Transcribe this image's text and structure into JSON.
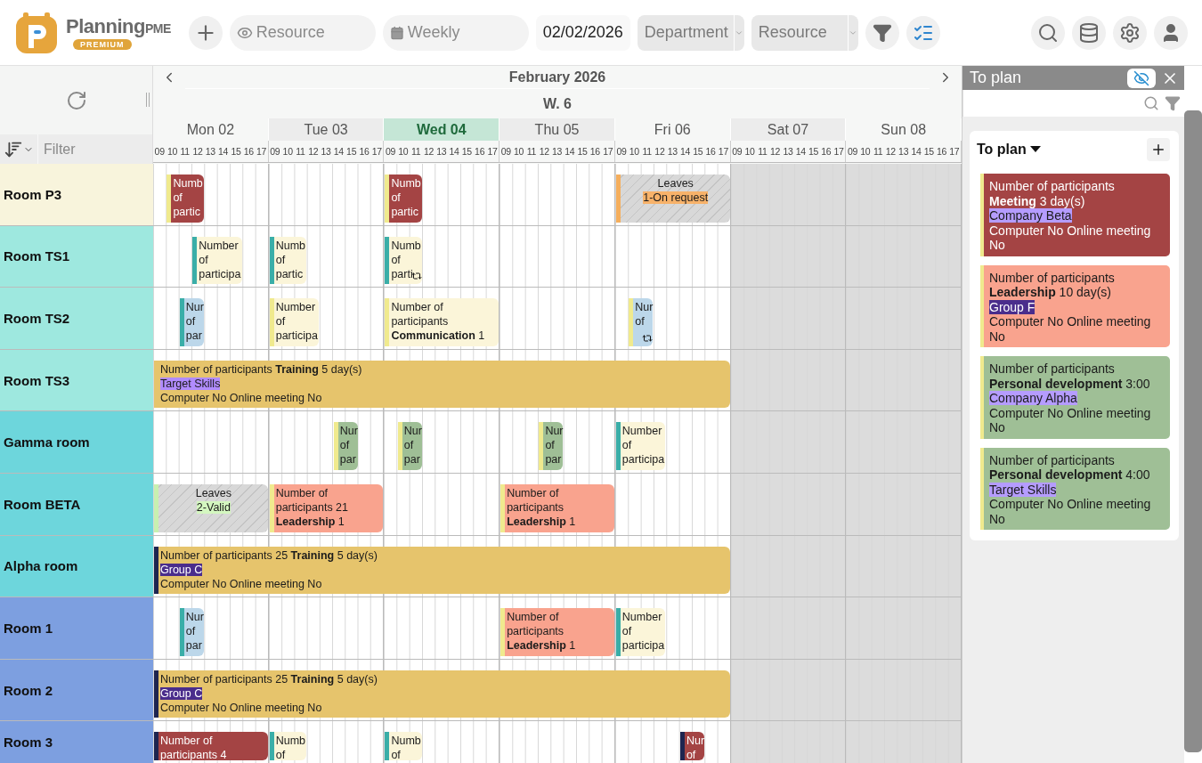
{
  "brand": {
    "name": "Planning",
    "suffix": "PME",
    "edition": "PREMIUM"
  },
  "toolbar": {
    "resource_filter": {
      "placeholder": "Resource"
    },
    "view": "Weekly",
    "date": "02/02/2026",
    "department": "Department",
    "resource_select": "Resource"
  },
  "planner": {
    "month": "February 2026",
    "week": "W. 6",
    "filter": {
      "placeholder": "Filter"
    },
    "days": [
      {
        "label": "Mon 02",
        "selected": false,
        "weekend": false,
        "hours": [
          "09",
          "10",
          "11",
          "12",
          "13",
          "14",
          "15",
          "16",
          "17"
        ]
      },
      {
        "label": "Tue 03",
        "selected": false,
        "weekend": false,
        "hours": [
          "09",
          "10",
          "11",
          "12",
          "13",
          "14",
          "15",
          "16",
          "17"
        ]
      },
      {
        "label": "Wed 04",
        "selected": true,
        "weekend": false,
        "hours": [
          "09",
          "10",
          "11",
          "12",
          "13",
          "14",
          "15",
          "16",
          "17"
        ]
      },
      {
        "label": "Thu 05",
        "selected": false,
        "weekend": false,
        "hours": [
          "09",
          "10",
          "11",
          "12",
          "13",
          "14",
          "15",
          "16",
          "17"
        ]
      },
      {
        "label": "Fri 06",
        "selected": false,
        "weekend": false,
        "hours": [
          "09",
          "10",
          "11",
          "12",
          "13",
          "14",
          "15",
          "16",
          "17"
        ]
      },
      {
        "label": "Sat 07",
        "selected": false,
        "weekend": true,
        "hours": [
          "09",
          "10",
          "11",
          "12",
          "13",
          "14",
          "15",
          "16",
          "17"
        ]
      },
      {
        "label": "Sun 08",
        "selected": false,
        "weekend": true,
        "hours": [
          "09",
          "10",
          "11",
          "12",
          "13",
          "14",
          "15",
          "16",
          "17"
        ]
      }
    ],
    "resources": [
      {
        "name": "Room P3",
        "color": "#f8f4dc",
        "events": [
          {
            "kind": "event",
            "color": "#a44444",
            "marker": {
              "color": "#f0ea8e"
            },
            "lines": [
              {
                "kind": "text",
                "text": "Numb"
              },
              {
                "kind": "text",
                "text": "of"
              },
              {
                "kind": "text",
                "text": "partic"
              }
            ]
          },
          {
            "kind": "event",
            "color": "#a44444",
            "marker": {
              "color": "#f0ea8e"
            },
            "lines": [
              {
                "kind": "text",
                "text": "Numb"
              },
              {
                "kind": "text",
                "text": "of"
              },
              {
                "kind": "text",
                "text": "partic"
              }
            ]
          },
          {
            "kind": "leave",
            "marker": {
              "color": "#f5ae5c"
            },
            "lines": [
              {
                "kind": "text",
                "text": "Leaves"
              },
              {
                "kind": "tag",
                "text": "1-On request",
                "color": "#f7b26a"
              }
            ]
          }
        ]
      },
      {
        "name": "Room TS1",
        "color": "#9ee8df",
        "events": [
          {
            "kind": "event",
            "color": "#fbf5d9",
            "marker": {
              "color": "#3aaea8"
            },
            "lines": [
              {
                "kind": "text",
                "text": "Number"
              },
              {
                "kind": "text",
                "text": "of"
              },
              {
                "kind": "text",
                "text": "participa"
              }
            ]
          },
          {
            "kind": "event",
            "color": "#fbf5d9",
            "marker": {
              "color": "#3aaea8"
            },
            "lines": [
              {
                "kind": "text",
                "text": "Numb"
              },
              {
                "kind": "text",
                "text": "of"
              },
              {
                "kind": "text",
                "text": "partic"
              }
            ]
          },
          {
            "kind": "event",
            "color": "#fbf5d9",
            "marker": {
              "color": "#3aaea8"
            },
            "repeat": true,
            "lines": [
              {
                "kind": "text",
                "text": "Numb"
              },
              {
                "kind": "text",
                "text": "of"
              },
              {
                "kind": "text",
                "text": "parti"
              }
            ]
          }
        ]
      },
      {
        "name": "Room TS2",
        "color": "#9ee8df",
        "events": [
          {
            "kind": "event",
            "color": "#bcd7ea",
            "marker": {
              "color": "#3aaea8"
            },
            "lines": [
              {
                "kind": "text",
                "text": "Nur"
              },
              {
                "kind": "text",
                "text": "of"
              },
              {
                "kind": "text",
                "text": "par"
              }
            ]
          },
          {
            "kind": "event",
            "color": "#fbf5d9",
            "marker": {
              "color": "#f0ea8e"
            },
            "lines": [
              {
                "kind": "text",
                "text": "Number"
              },
              {
                "kind": "text",
                "text": "of"
              },
              {
                "kind": "text",
                "text": "participa"
              }
            ]
          },
          {
            "kind": "event",
            "color": "#fbf5d9",
            "marker": {
              "color": "#f0ea8e"
            },
            "lines": [
              {
                "kind": "text",
                "text": "Number of"
              },
              {
                "kind": "text",
                "text": "participants"
              },
              {
                "kind": "text",
                "text": "**Communication** 1"
              }
            ]
          },
          {
            "kind": "event",
            "color": "#bcd7ea",
            "marker": {
              "color": "#f0ea8e"
            },
            "repeat": true,
            "lines": [
              {
                "kind": "text",
                "text": "Nur"
              },
              {
                "kind": "text",
                "text": "of"
              }
            ]
          }
        ]
      },
      {
        "name": "Room TS3",
        "color": "#9ee8df",
        "events": [
          {
            "kind": "event",
            "color": "#e6c46c",
            "marker": {
              "color": "#e6c46c"
            },
            "lines": [
              {
                "kind": "text",
                "text": "Number of participants **Training** 5 day(s)"
              },
              {
                "kind": "tag",
                "text": "Target Skills",
                "color": "#b18cff"
              },
              {
                "kind": "text",
                "text": "Computer No Online meeting No"
              }
            ]
          }
        ]
      },
      {
        "name": "Gamma room",
        "color": "#6dd6dc",
        "events": [
          {
            "kind": "event",
            "color": "#9fbf96",
            "marker": {
              "color": "#f0ea8e"
            },
            "lines": [
              {
                "kind": "text",
                "text": "Nur"
              },
              {
                "kind": "text",
                "text": "of"
              },
              {
                "kind": "text",
                "text": "par"
              }
            ]
          },
          {
            "kind": "event",
            "color": "#9fbf96",
            "marker": {
              "color": "#f0ea8e"
            },
            "lines": [
              {
                "kind": "text",
                "text": "Nur"
              },
              {
                "kind": "text",
                "text": "of"
              },
              {
                "kind": "text",
                "text": "par"
              }
            ]
          },
          {
            "kind": "event",
            "color": "#9fbf96",
            "marker": {
              "color": "#f0ea8e"
            },
            "lines": [
              {
                "kind": "text",
                "text": "Nur"
              },
              {
                "kind": "text",
                "text": "of"
              },
              {
                "kind": "text",
                "text": "par"
              }
            ]
          },
          {
            "kind": "event",
            "color": "#fbf5d9",
            "marker": {
              "color": "#3aaea8"
            },
            "lines": [
              {
                "kind": "text",
                "text": "Number"
              },
              {
                "kind": "text",
                "text": "of"
              },
              {
                "kind": "text",
                "text": "participa"
              }
            ]
          }
        ]
      },
      {
        "name": "Room BETA",
        "color": "#6dd6dc",
        "events": [
          {
            "kind": "leave",
            "marker": {
              "color": "#c8f0b0"
            },
            "lines": [
              {
                "kind": "text",
                "text": "Leaves"
              },
              {
                "kind": "tag",
                "text": "2-Valid",
                "color": "#d4f7c0"
              }
            ]
          },
          {
            "kind": "event",
            "color": "#f9a38e",
            "marker": {
              "color": "#f0ea8e"
            },
            "lines": [
              {
                "kind": "text",
                "text": "Number of"
              },
              {
                "kind": "text",
                "text": "participants 21"
              },
              {
                "kind": "text",
                "text": "**Leadership** 1"
              }
            ]
          },
          {
            "kind": "event",
            "color": "#f9a38e",
            "marker": {
              "color": "#f0ea8e"
            },
            "lines": [
              {
                "kind": "text",
                "text": "Number of"
              },
              {
                "kind": "text",
                "text": "participants"
              },
              {
                "kind": "text",
                "text": "**Leadership** 1"
              }
            ]
          }
        ]
      },
      {
        "name": "Alpha room",
        "color": "#6dd6dc",
        "events": [
          {
            "kind": "event",
            "color": "#e6c46c",
            "marker": {
              "color": "#1e2550"
            },
            "lines": [
              {
                "kind": "text",
                "text": "Number of participants 25 **Training** 5 day(s)"
              },
              {
                "kind": "tag",
                "text": "Group C",
                "color": "#4a2d8c"
              },
              {
                "kind": "text",
                "text": "Computer No Online meeting No"
              }
            ]
          }
        ]
      },
      {
        "name": "Room 1",
        "color": "#7d9fe0",
        "events": [
          {
            "kind": "event",
            "color": "#bcd7ea",
            "marker": {
              "color": "#3aaea8"
            },
            "lines": [
              {
                "kind": "text",
                "text": "Nur"
              },
              {
                "kind": "text",
                "text": "of"
              },
              {
                "kind": "text",
                "text": "par"
              }
            ]
          },
          {
            "kind": "event",
            "color": "#f9a38e",
            "marker": {
              "color": "#f0ea8e"
            },
            "lines": [
              {
                "kind": "text",
                "text": "Number of"
              },
              {
                "kind": "text",
                "text": "participants"
              },
              {
                "kind": "text",
                "text": "**Leadership** 1"
              }
            ]
          },
          {
            "kind": "event",
            "color": "#fbf5d9",
            "marker": {
              "color": "#3aaea8"
            },
            "lines": [
              {
                "kind": "text",
                "text": "Number"
              },
              {
                "kind": "text",
                "text": "of"
              },
              {
                "kind": "text",
                "text": "participa"
              }
            ]
          }
        ]
      },
      {
        "name": "Room 2",
        "color": "#7d9fe0",
        "events": [
          {
            "kind": "event",
            "color": "#e6c46c",
            "marker": {
              "color": "#1e2550"
            },
            "lines": [
              {
                "kind": "text",
                "text": "Number of participants 25 **Training** 5 day(s)"
              },
              {
                "kind": "tag",
                "text": "Group C",
                "color": "#4a2d8c"
              },
              {
                "kind": "text",
                "text": "Computer No Online meeting No"
              }
            ]
          }
        ]
      },
      {
        "name": "Room 3",
        "color": "#7d9fe0",
        "events": [
          {
            "kind": "event",
            "color": "#a44444",
            "marker": {
              "color": "#1e2550"
            },
            "lines": [
              {
                "kind": "text",
                "text": "Number of"
              },
              {
                "kind": "text",
                "text": "participants 4"
              }
            ]
          },
          {
            "kind": "event",
            "color": "#fbf5d9",
            "marker": {
              "color": "#3aaea8"
            },
            "lines": [
              {
                "kind": "text",
                "text": "Numb"
              },
              {
                "kind": "text",
                "text": "of"
              }
            ]
          },
          {
            "kind": "event",
            "color": "#fbf5d9",
            "marker": {
              "color": "#3aaea8"
            },
            "lines": [
              {
                "kind": "text",
                "text": "Numb"
              },
              {
                "kind": "text",
                "text": "of"
              }
            ]
          },
          {
            "kind": "event",
            "color": "#a44444",
            "marker": {
              "color": "#1e2550"
            },
            "lines": [
              {
                "kind": "text",
                "text": "Nur"
              },
              {
                "kind": "text",
                "text": "of"
              }
            ]
          }
        ]
      }
    ]
  },
  "to_plan": {
    "title": "To plan",
    "list_title": "To plan",
    "cards": [
      {
        "color": "#a44444",
        "marker": {
          "color": "#f0ea8e"
        },
        "lines": [
          {
            "kind": "text",
            "text": "Number of participants"
          },
          {
            "kind": "text",
            "text": "**Meeting** 3 day(s)"
          },
          {
            "kind": "tag",
            "text": "Company Beta",
            "color": "#b59cff"
          },
          {
            "kind": "text",
            "text": "Computer No Online meeting No"
          }
        ]
      },
      {
        "color": "#f9a38e",
        "marker": {
          "color": "#f0ea8e"
        },
        "lines": [
          {
            "kind": "text",
            "text": "Number of participants"
          },
          {
            "kind": "text",
            "text": "**Leadership** 10 day(s)"
          },
          {
            "kind": "tag",
            "text": "Group F",
            "color": "#4a2d8c"
          },
          {
            "kind": "text",
            "text": "Computer No Online meeting No"
          }
        ]
      },
      {
        "color": "#9fbf96",
        "marker": {
          "color": "#f0ea8e"
        },
        "lines": [
          {
            "kind": "text",
            "text": "Number of participants"
          },
          {
            "kind": "text",
            "text": "**Personal development** 3:00"
          },
          {
            "kind": "tag",
            "text": "Company Alpha",
            "color": "#b59cff"
          },
          {
            "kind": "text",
            "text": "Computer No Online meeting No"
          }
        ]
      },
      {
        "color": "#9fbf96",
        "marker": {
          "color": "#f0ea8e"
        },
        "lines": [
          {
            "kind": "text",
            "text": "Number of participants"
          },
          {
            "kind": "text",
            "text": "**Personal development** 4:00"
          },
          {
            "kind": "tag",
            "text": "Target Skills",
            "color": "#b59cff"
          },
          {
            "kind": "text",
            "text": "Computer No Online meeting No"
          }
        ]
      }
    ]
  }
}
